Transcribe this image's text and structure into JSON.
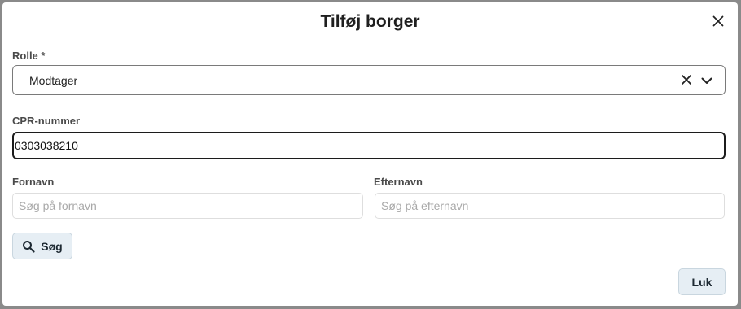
{
  "dialog": {
    "title": "Tilføj borger",
    "close_icon": "close-icon"
  },
  "role": {
    "label": "Rolle *",
    "value": "Modtager",
    "clear_icon": "clear-icon",
    "toggle_icon": "chevron-down-icon"
  },
  "cpr": {
    "label": "CPR-nummer",
    "value": "0303038210"
  },
  "firstname": {
    "label": "Fornavn",
    "placeholder": "Søg på fornavn",
    "value": ""
  },
  "lastname": {
    "label": "Efternavn",
    "placeholder": "Søg på efternavn",
    "value": ""
  },
  "buttons": {
    "search_label": "Søg",
    "search_icon": "search-icon",
    "close_label": "Luk"
  }
}
